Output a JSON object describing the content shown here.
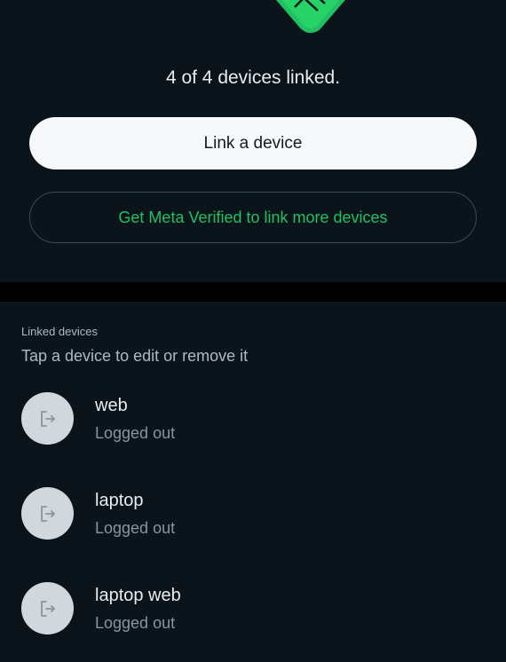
{
  "status": {
    "devices_linked_text": "4 of 4 devices linked."
  },
  "actions": {
    "link_device_label": "Link a device",
    "get_verified_label": "Get Meta Verified to link more devices"
  },
  "linked_devices": {
    "header": "Linked devices",
    "subheader": "Tap a device to edit or remove it",
    "items": [
      {
        "name": "web",
        "status": "Logged out",
        "icon": "logout-icon"
      },
      {
        "name": "laptop",
        "status": "Logged out",
        "icon": "logout-icon"
      },
      {
        "name": "laptop web",
        "status": "Logged out",
        "icon": "logout-icon"
      }
    ]
  },
  "colors": {
    "background": "#0b141a",
    "accent_green": "#21c063",
    "button_light": "#f7f8fa",
    "avatar_bg": "#d1d7db"
  }
}
